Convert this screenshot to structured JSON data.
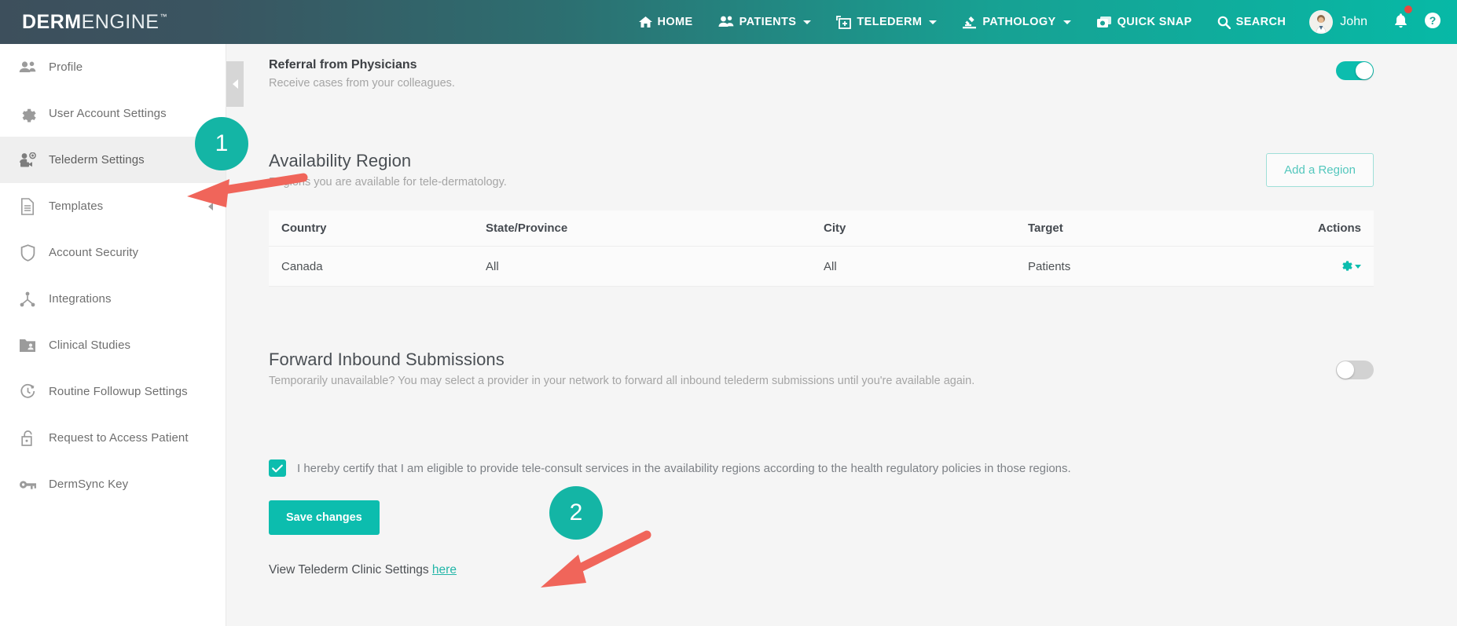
{
  "brand": {
    "bold": "DERM",
    "light": "ENGINE",
    "tm": "™"
  },
  "topnav": {
    "items": [
      {
        "label": "HOME",
        "icon": "home-icon",
        "caret": false
      },
      {
        "label": "PATIENTS",
        "icon": "patients-icon",
        "caret": true
      },
      {
        "label": "TELEDERM",
        "icon": "telederm-icon",
        "caret": true
      },
      {
        "label": "PATHOLOGY",
        "icon": "microscope-icon",
        "caret": true
      },
      {
        "label": "QUICK SNAP",
        "icon": "camera-icon",
        "caret": false
      },
      {
        "label": "SEARCH",
        "icon": "search-icon",
        "caret": false
      }
    ],
    "user": {
      "name": "John",
      "avatar": "doctor-avatar"
    },
    "notifications_icon": "bell-icon",
    "help_icon": "help-circle-icon"
  },
  "sidebar": {
    "items": [
      {
        "label": "Profile",
        "icon": "people-icon",
        "active": false,
        "caret": false
      },
      {
        "label": "User Account Settings",
        "icon": "gear-icon",
        "active": false,
        "caret": false
      },
      {
        "label": "Telederm Settings",
        "icon": "user-camera-icon",
        "active": true,
        "caret": false
      },
      {
        "label": "Templates",
        "icon": "document-icon",
        "active": false,
        "caret": true
      },
      {
        "label": "Account Security",
        "icon": "shield-icon",
        "active": false,
        "caret": false
      },
      {
        "label": "Integrations",
        "icon": "network-icon",
        "active": false,
        "caret": false
      },
      {
        "label": "Clinical Studies",
        "icon": "folder-user-icon",
        "active": false,
        "caret": false
      },
      {
        "label": "Routine Followup Settings",
        "icon": "clock-refresh-icon",
        "active": false,
        "caret": false
      },
      {
        "label": "Request to Access Patient",
        "icon": "unlock-icon",
        "active": false,
        "caret": false
      },
      {
        "label": "DermSync Key",
        "icon": "key-icon",
        "active": false,
        "caret": false
      }
    ]
  },
  "main": {
    "referral": {
      "title": "Referral from Physicians",
      "subtitle": "Receive cases from your colleagues.",
      "toggle_state": "on"
    },
    "availability": {
      "title": "Availability Region",
      "subtitle": "Regions you are available for tele-dermatology.",
      "add_button": "Add a Region",
      "table": {
        "headers": [
          "Country",
          "State/Province",
          "City",
          "Target",
          "Actions"
        ],
        "rows": [
          {
            "country": "Canada",
            "state": "All",
            "city": "All",
            "target": "Patients",
            "action_icon": "gear-dropdown-icon"
          }
        ]
      }
    },
    "forward": {
      "title": "Forward Inbound Submissions",
      "subtitle": "Temporarily unavailable? You may select a provider in your network to forward all inbound telederm submissions until you're available again.",
      "toggle_state": "off"
    },
    "certify": {
      "checked": true,
      "text": "I hereby certify that I am eligible to provide tele-consult services in the availability regions according to the health regulatory policies in those regions."
    },
    "save_button": "Save changes",
    "footer_link": {
      "prefix": "View Telederm Clinic Settings",
      "link": "here"
    }
  },
  "annotations": {
    "badges": [
      {
        "number": "1"
      },
      {
        "number": "2"
      }
    ],
    "arrow_color": "#f0655a"
  },
  "colors": {
    "accent": "#0cbdae",
    "nav_gradient_start": "#3d4f5c",
    "nav_gradient_end": "#07b9a6",
    "annotation": "#f0655a",
    "badge": "#14b5a5"
  }
}
